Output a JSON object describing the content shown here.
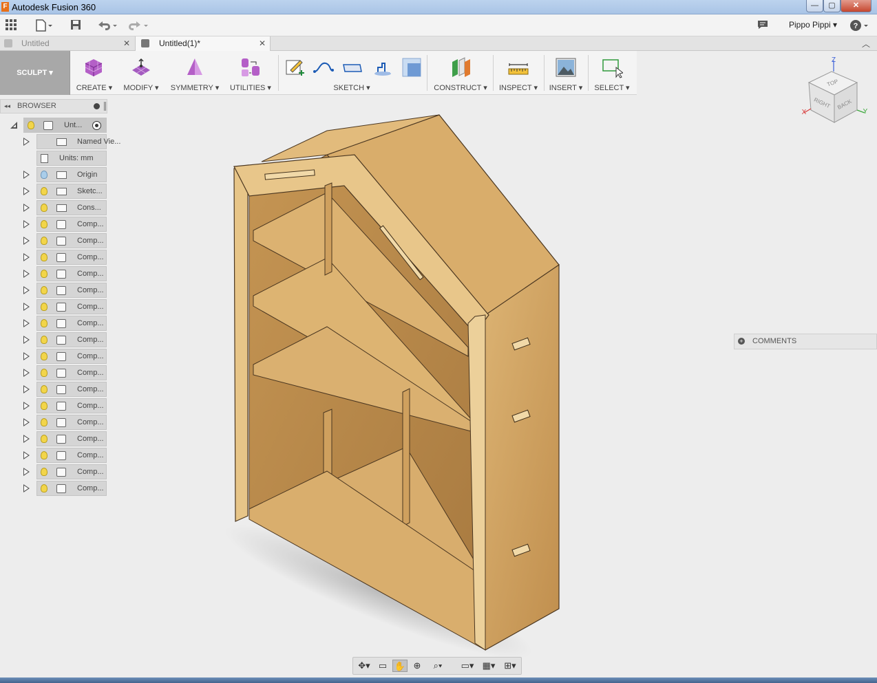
{
  "window": {
    "title": "Autodesk Fusion 360",
    "logo": "F",
    "minimize": "—",
    "maximize": "▢",
    "close": "✕"
  },
  "quick_access": {
    "user_name": "Pippo Pippi ▾",
    "help": "?"
  },
  "tabs": [
    {
      "label": "Untitled",
      "active": false
    },
    {
      "label": "Untitled(1)*",
      "active": true
    }
  ],
  "toolbar": {
    "workspace": "SCULPT ▾",
    "groups": {
      "create": "CREATE ▾",
      "modify": "MODIFY ▾",
      "symmetry": "SYMMETRY ▾",
      "utilities": "UTILITIES ▾",
      "sketch": "SKETCH ▾",
      "construct": "CONSTRUCT ▾",
      "inspect": "INSPECT ▾",
      "insert": "INSERT ▾",
      "select": "SELECT ▾"
    }
  },
  "browser": {
    "title": "BROWSER",
    "root_label": "Unt...",
    "items": [
      {
        "label": "Named Vie...",
        "icon": "folder-icon",
        "bulb": "none"
      },
      {
        "label": "Units: mm",
        "icon": "document-icon",
        "bulb": "none"
      },
      {
        "label": "Origin",
        "icon": "folder-icon",
        "bulb": "off"
      },
      {
        "label": "Sketc...",
        "icon": "folder-icon",
        "bulb": "on"
      },
      {
        "label": "Cons...",
        "icon": "folder-icon",
        "bulb": "on"
      },
      {
        "label": "Comp...",
        "icon": "component-icon",
        "bulb": "on"
      },
      {
        "label": "Comp...",
        "icon": "component-icon",
        "bulb": "on"
      },
      {
        "label": "Comp...",
        "icon": "component-icon",
        "bulb": "on"
      },
      {
        "label": "Comp...",
        "icon": "component-icon",
        "bulb": "on"
      },
      {
        "label": "Comp...",
        "icon": "component-icon",
        "bulb": "on"
      },
      {
        "label": "Comp...",
        "icon": "component-icon",
        "bulb": "on"
      },
      {
        "label": "Comp...",
        "icon": "component-icon",
        "bulb": "on"
      },
      {
        "label": "Comp...",
        "icon": "component-icon",
        "bulb": "on"
      },
      {
        "label": "Comp...",
        "icon": "component-icon",
        "bulb": "on"
      },
      {
        "label": "Comp...",
        "icon": "component-icon",
        "bulb": "on"
      },
      {
        "label": "Comp...",
        "icon": "component-icon",
        "bulb": "on"
      },
      {
        "label": "Comp...",
        "icon": "component-icon",
        "bulb": "on"
      },
      {
        "label": "Comp...",
        "icon": "component-icon",
        "bulb": "on"
      },
      {
        "label": "Comp...",
        "icon": "component-icon",
        "bulb": "on"
      },
      {
        "label": "Comp...",
        "icon": "component-icon",
        "bulb": "on"
      },
      {
        "label": "Comp...",
        "icon": "component-icon",
        "bulb": "on"
      },
      {
        "label": "Comp...",
        "icon": "component-icon",
        "bulb": "on"
      }
    ]
  },
  "viewcube": {
    "top": "TOP",
    "right": "RIGHT",
    "back": "BACK",
    "axis_x": "X",
    "axis_y": "Y",
    "axis_z": "Z"
  },
  "comments": {
    "label": "COMMENTS"
  },
  "colors": {
    "wood_light": "#e4be82",
    "wood_mid": "#d2a462",
    "wood_dark": "#b8894c",
    "accent_orange": "#e8701a"
  }
}
